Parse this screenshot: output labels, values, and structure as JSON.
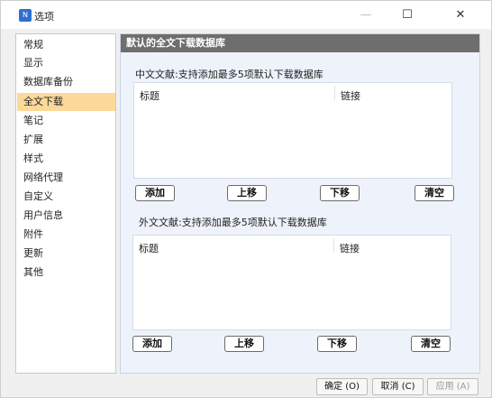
{
  "window": {
    "title": "选项",
    "app_icon": "N",
    "controls": {
      "minimize": "—",
      "maximize": "☐",
      "close": "✕"
    }
  },
  "sidebar": {
    "items": [
      {
        "label": "常规",
        "active": false
      },
      {
        "label": "显示",
        "active": false
      },
      {
        "label": "数据库备份",
        "active": false
      },
      {
        "label": "全文下载",
        "active": true
      },
      {
        "label": "笔记",
        "active": false
      },
      {
        "label": "扩展",
        "active": false
      },
      {
        "label": "样式",
        "active": false
      },
      {
        "label": "网络代理",
        "active": false
      },
      {
        "label": "自定义",
        "active": false
      },
      {
        "label": "用户信息",
        "active": false
      },
      {
        "label": "附件",
        "active": false
      },
      {
        "label": "更新",
        "active": false
      },
      {
        "label": "其他",
        "active": false
      }
    ]
  },
  "main": {
    "header": "默认的全文下载数据库",
    "chinese": {
      "label": "中文文献:支持添加最多5项默认下载数据库",
      "columns": [
        "标题",
        "链接"
      ],
      "buttons": {
        "add": "添加",
        "up": "上移",
        "down": "下移",
        "clear": "清空"
      }
    },
    "foreign": {
      "label": "外文文献:支持添加最多5项默认下载数据库",
      "columns": [
        "标题",
        "链接"
      ],
      "buttons": {
        "add": "添加",
        "up": "上移",
        "down": "下移",
        "clear": "清空"
      }
    }
  },
  "footer": {
    "ok": "确定 (O)",
    "cancel": "取消 (C)",
    "apply": "应用 (A)"
  },
  "colors": {
    "active_item": "#fbd99a",
    "header_bg": "#6e6e6e",
    "content_bg": "#eef3fb"
  }
}
